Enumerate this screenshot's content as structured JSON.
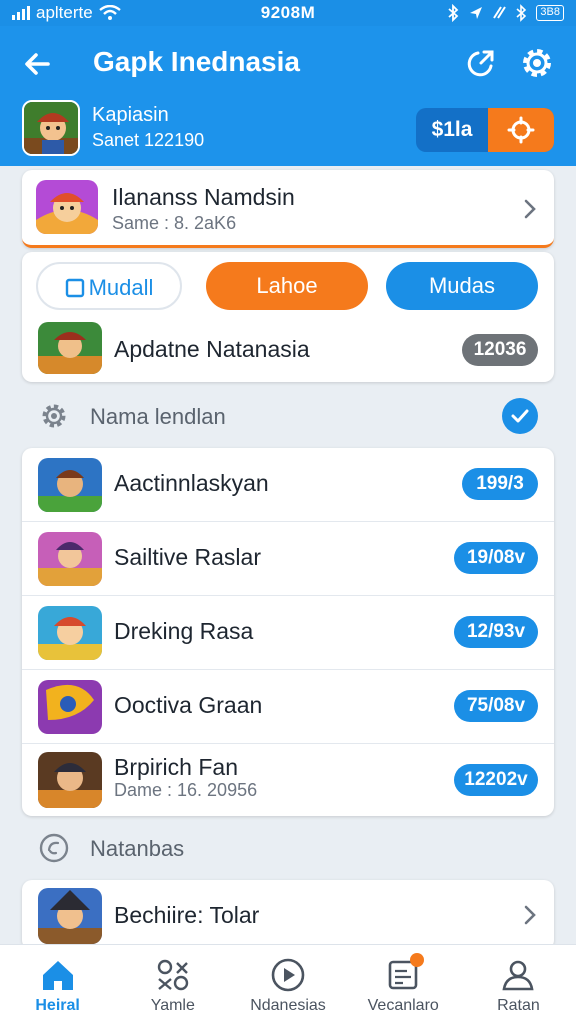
{
  "status_bar": {
    "carrier": "aplterte",
    "time": "9208M",
    "battery": "3B8"
  },
  "header": {
    "title": "Gapk Inednasia"
  },
  "user": {
    "name": "Kapiasin",
    "sub": "Sanet 122190",
    "balance": "$1la"
  },
  "featured": {
    "title": "Ilananss Namdsin",
    "sub": "Same : 8. 2aK6"
  },
  "tabs": [
    {
      "label": "Mudall"
    },
    {
      "label": "Lahoe"
    },
    {
      "label": "Mudas"
    }
  ],
  "top_item": {
    "title": "Apdatne Natanasia",
    "badge": "12036"
  },
  "section_1": {
    "label": "Nama lendlan"
  },
  "list": [
    {
      "title": "Aactinnlaskyan",
      "badge": "199/3"
    },
    {
      "title": "Sailtive Raslar",
      "badge": "19/08v"
    },
    {
      "title": "Dreking Rasa",
      "badge": "12/93v"
    },
    {
      "title": "Ooctiva Graan",
      "badge": "75/08v"
    },
    {
      "title": "Brpirich Fan",
      "sub": "Dame : 16. 20956",
      "badge": "12202v"
    }
  ],
  "section_2": {
    "label": "Natanbas"
  },
  "last_item": {
    "title": "Bechiire: Tolar"
  },
  "nav": [
    {
      "label": "Heiral",
      "icon": "home-icon"
    },
    {
      "label": "Yamle",
      "icon": "games-icon"
    },
    {
      "label": "Ndanesias",
      "icon": "play-icon"
    },
    {
      "label": "Vecanlaro",
      "icon": "notification-icon"
    },
    {
      "label": "Ratan",
      "icon": "profile-icon"
    }
  ],
  "colors": {
    "primary": "#1b8fe6",
    "accent": "#f57a1c",
    "badge_grey": "#6e7378"
  }
}
